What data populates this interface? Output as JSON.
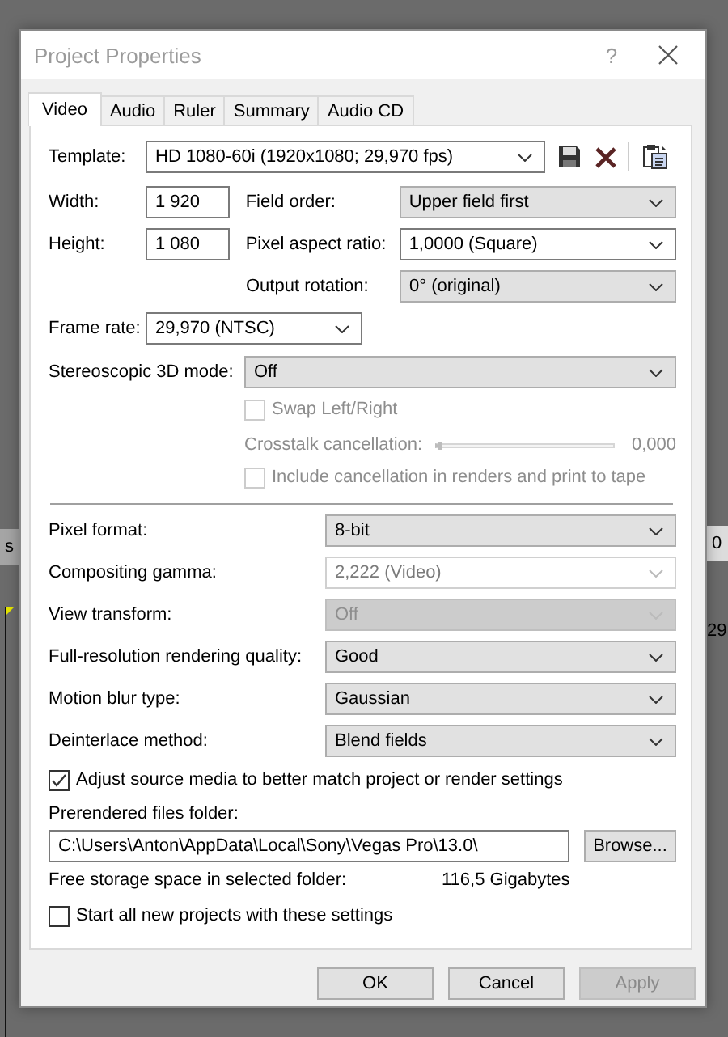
{
  "window": {
    "title": "Project Properties",
    "help": "?"
  },
  "tabs": [
    {
      "label": "Video",
      "selected": true
    },
    {
      "label": "Audio",
      "selected": false
    },
    {
      "label": "Ruler",
      "selected": false
    },
    {
      "label": "Summary",
      "selected": false
    },
    {
      "label": "Audio CD",
      "selected": false
    }
  ],
  "template": {
    "label": "Template:",
    "value": "HD 1080-60i (1920x1080; 29,970 fps)",
    "kind": "editable",
    "disabled": false
  },
  "width": {
    "label": "Width:",
    "value": "1 920"
  },
  "height": {
    "label": "Height:",
    "value": "1 080"
  },
  "field_order": {
    "label": "Field order:",
    "value": "Upper field first",
    "kind": "list",
    "disabled": false
  },
  "pixel_aspect_ratio": {
    "label": "Pixel aspect ratio:",
    "value": "1,0000 (Square)",
    "kind": "editable",
    "disabled": false
  },
  "output_rotation": {
    "label": "Output rotation:",
    "value": "0° (original)",
    "kind": "list",
    "disabled": false
  },
  "frame_rate": {
    "label": "Frame rate:",
    "value": "29,970 (NTSC)",
    "kind": "editable",
    "disabled": false
  },
  "stereoscopic_3d_mode": {
    "label": "Stereoscopic 3D mode:",
    "value": "Off",
    "kind": "list",
    "disabled": false
  },
  "swap_left_right": {
    "label": "Swap Left/Right",
    "checked": false,
    "disabled": true
  },
  "crosstalk_cancellation": {
    "label": "Crosstalk cancellation:",
    "level": 0,
    "reading": "0,000",
    "disabled": true
  },
  "include_cancellation": {
    "label": "Include cancellation in renders and print to tape",
    "checked": false,
    "disabled": true
  },
  "settings": [
    {
      "label": "Pixel format:",
      "value": "8-bit",
      "kind": "list",
      "disabled": false
    },
    {
      "label": "Compositing gamma:",
      "value": "2,222 (Video)",
      "kind": "editable",
      "disabled": true
    },
    {
      "label": "View transform:",
      "value": "Off",
      "kind": "list",
      "disabled": true
    },
    {
      "label": "Full-resolution rendering quality:",
      "value": "Good",
      "kind": "list",
      "disabled": false
    },
    {
      "label": "Motion blur type:",
      "value": "Gaussian",
      "kind": "list",
      "disabled": false
    },
    {
      "label": "Deinterlace method:",
      "value": "Blend fields",
      "kind": "list",
      "disabled": false
    }
  ],
  "adjust_source_media": {
    "label": "Adjust source media to better match project or render settings",
    "checked": true,
    "disabled": false
  },
  "prerendered_files_folder": {
    "label": "Prerendered files folder:",
    "value": "C:\\Users\\Anton\\AppData\\Local\\Sony\\Vegas Pro\\13.0\\",
    "browse": "Browse..."
  },
  "free_storage": {
    "label": "Free storage space in selected folder:",
    "value": "116,5 Gigabytes"
  },
  "start_all_new_projects": {
    "label": "Start all new projects with these settings",
    "checked": false,
    "disabled": false
  },
  "buttons": [
    {
      "label": "OK",
      "disabled": false
    },
    {
      "label": "Cancel",
      "disabled": false
    },
    {
      "label": "Apply",
      "disabled": true
    }
  ],
  "background_fragments": [
    "s",
    "0",
    "29"
  ]
}
